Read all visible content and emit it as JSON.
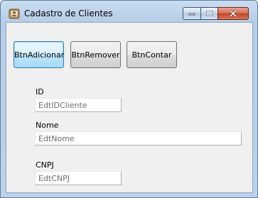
{
  "window": {
    "title": "Cadastro de Clientes"
  },
  "toolbar": {
    "add_label": "BtnAdicionar",
    "remove_label": "BtnRemover",
    "count_label": "BtnContar"
  },
  "form": {
    "id_label": "ID",
    "id_value": "EdtIDCliente",
    "name_label": "Nome",
    "name_value": "EdtNome",
    "cnpj_label": "CNPJ",
    "cnpj_value": "EdtCNPJ"
  },
  "icons": {
    "app": "app-icon",
    "minimize": "minimize-icon",
    "maximize": "maximize-icon",
    "close": "close-icon"
  },
  "colors": {
    "titlebar": "#c9dcf0",
    "client_bg": "#f0f0f0",
    "focused_button": "#bee6fd",
    "close_button": "#c2411f"
  }
}
